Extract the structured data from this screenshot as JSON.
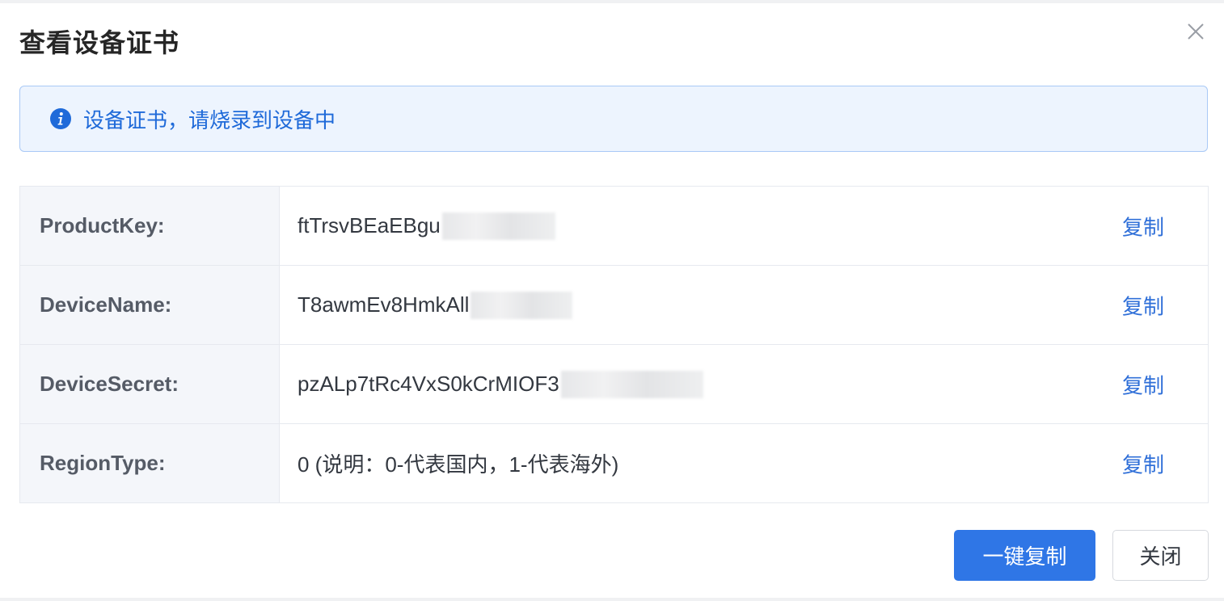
{
  "dialog": {
    "title": "查看设备证书",
    "close_icon": "close-icon"
  },
  "alert": {
    "icon": "info-icon",
    "text": "设备证书，请烧录到设备中",
    "color": "#1f6ad9"
  },
  "certificate": {
    "rows": [
      {
        "key": "ProductKey:",
        "value": "ftTrsvBEaEBgu",
        "copy_label": "复制"
      },
      {
        "key": "DeviceName:",
        "value": "T8awmEv8HmkAll",
        "copy_label": "复制"
      },
      {
        "key": "DeviceSecret:",
        "value": "pzALp7tRc4VxS0kCrMIOF3",
        "copy_label": "复制"
      },
      {
        "key": "RegionType:",
        "value": "0 (说明：0-代表国内，1-代表海外)",
        "copy_label": "复制"
      }
    ]
  },
  "footer": {
    "copy_all_label": "一键复制",
    "close_label": "关闭",
    "primary_color": "#2f76e6"
  }
}
